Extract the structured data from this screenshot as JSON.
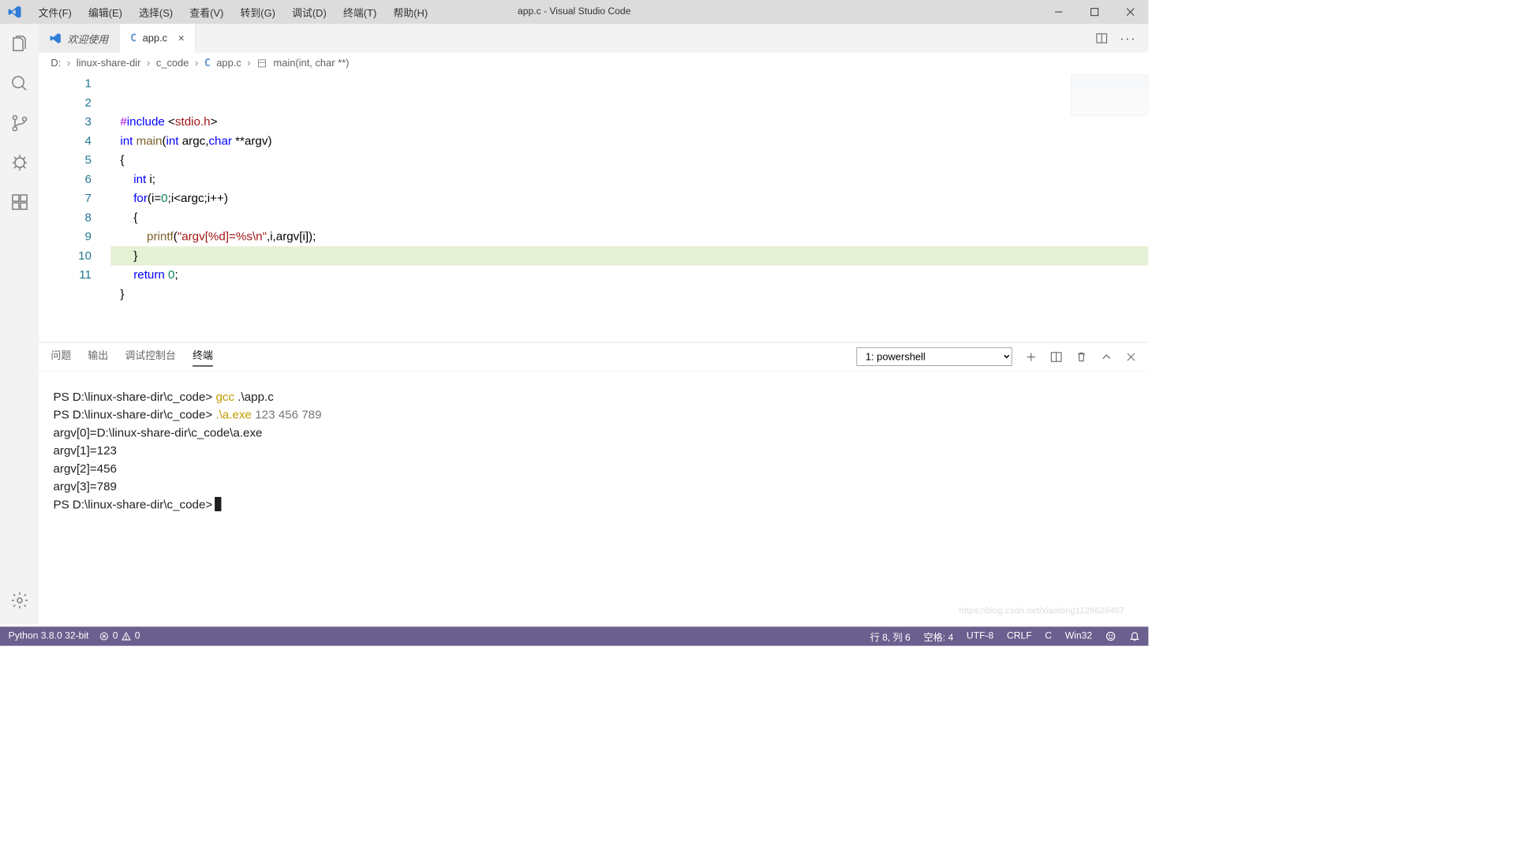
{
  "titlebar": {
    "title": "app.c - Visual Studio Code",
    "menus": [
      "文件(F)",
      "编辑(E)",
      "选择(S)",
      "查看(V)",
      "转到(G)",
      "调试(D)",
      "终端(T)",
      "帮助(H)"
    ]
  },
  "tabs": {
    "welcome": "欢迎使用",
    "file": "app.c"
  },
  "breadcrumb": {
    "parts": [
      "D:",
      "linux-share-dir",
      "c_code",
      "app.c",
      "main(int, char **)"
    ]
  },
  "code": {
    "lines": [
      {
        "n": 1,
        "tokens": [
          {
            "t": "#",
            "c": "pp"
          },
          {
            "t": "include",
            "c": "kw"
          },
          {
            "t": " <",
            "c": ""
          },
          {
            "t": "stdio.h",
            "c": "ang"
          },
          {
            "t": ">",
            "c": ""
          }
        ]
      },
      {
        "n": 2,
        "tokens": [
          {
            "t": "int",
            "c": "kw"
          },
          {
            "t": " ",
            "c": ""
          },
          {
            "t": "main",
            "c": "fn"
          },
          {
            "t": "(",
            "c": ""
          },
          {
            "t": "int",
            "c": "kw"
          },
          {
            "t": " argc,",
            "c": ""
          },
          {
            "t": "char",
            "c": "kw"
          },
          {
            "t": " **argv)",
            "c": ""
          }
        ]
      },
      {
        "n": 3,
        "tokens": [
          {
            "t": "{",
            "c": ""
          }
        ]
      },
      {
        "n": 4,
        "tokens": [
          {
            "t": "    ",
            "c": ""
          },
          {
            "t": "int",
            "c": "kw"
          },
          {
            "t": " i;",
            "c": ""
          }
        ]
      },
      {
        "n": 5,
        "tokens": [
          {
            "t": "    ",
            "c": ""
          },
          {
            "t": "for",
            "c": "kw"
          },
          {
            "t": "(i=",
            "c": ""
          },
          {
            "t": "0",
            "c": "num"
          },
          {
            "t": ";i<argc;i++)",
            "c": ""
          }
        ]
      },
      {
        "n": 6,
        "tokens": [
          {
            "t": "    {",
            "c": ""
          }
        ]
      },
      {
        "n": 7,
        "tokens": [
          {
            "t": "        ",
            "c": ""
          },
          {
            "t": "printf",
            "c": "fn"
          },
          {
            "t": "(",
            "c": ""
          },
          {
            "t": "\"argv[%d]=%s\\n\"",
            "c": "str"
          },
          {
            "t": ",i,argv[i]);",
            "c": ""
          }
        ]
      },
      {
        "n": 8,
        "tokens": [
          {
            "t": "    }",
            "c": ""
          }
        ],
        "hl": true
      },
      {
        "n": 9,
        "tokens": [
          {
            "t": "    ",
            "c": ""
          },
          {
            "t": "return",
            "c": "kw"
          },
          {
            "t": " ",
            "c": ""
          },
          {
            "t": "0",
            "c": "num"
          },
          {
            "t": ";",
            "c": ""
          }
        ]
      },
      {
        "n": 10,
        "tokens": [
          {
            "t": "}",
            "c": ""
          }
        ]
      },
      {
        "n": 11,
        "tokens": [
          {
            "t": "",
            "c": ""
          }
        ]
      }
    ]
  },
  "panel": {
    "tabs": [
      "问题",
      "输出",
      "调试控制台",
      "终端"
    ],
    "activeTab": 3,
    "terminalSelect": "1: powershell",
    "terminal": {
      "prompt": "PS D:\\linux-share-dir\\c_code>",
      "lines": [
        {
          "prompt": "PS D:\\linux-share-dir\\c_code>",
          "cmd": " gcc",
          ".cls": "term-cmd1",
          "arg": " .\\app.c"
        },
        {
          "prompt": "PS D:\\linux-share-dir\\c_code>",
          "cmd": " .\\a.exe",
          ".cls": "term-cmd2",
          "arg2": " 123 456 789"
        },
        {
          "out": "argv[0]=D:\\linux-share-dir\\c_code\\a.exe"
        },
        {
          "out": "argv[1]=123"
        },
        {
          "out": "argv[2]=456"
        },
        {
          "out": "argv[3]=789"
        },
        {
          "prompt": "PS D:\\linux-share-dir\\c_code>",
          "cursor": true
        }
      ]
    }
  },
  "status": {
    "python": "Python 3.8.0 32-bit",
    "errors": "0",
    "warnings": "0",
    "lncol": "行 8,  列 6",
    "spaces": "空格: 4",
    "encoding": "UTF-8",
    "eol": "CRLF",
    "lang": "C",
    "os": "Win32"
  },
  "watermark": "https://blog.csdn.net/xiaolong1126626497"
}
